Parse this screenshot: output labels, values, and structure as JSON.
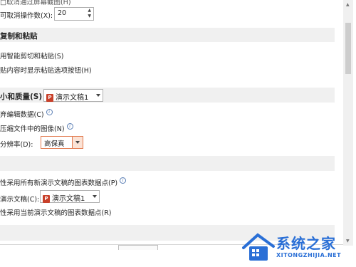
{
  "top_row": {
    "partial_label": "□取消通过屏幕截图(H)",
    "undo_label": "可取消操作数(X):",
    "undo_value": "20"
  },
  "section_copy": {
    "title": "复制和粘贴",
    "smart_cut": "用智能剪切和粘贴(S)",
    "show_paste": "贴内容时显示粘贴选项按钮(H)"
  },
  "section_size": {
    "title": "小和质量(S)",
    "doc_select": "演示文稿1",
    "discard_edit": "弃编辑数据(C)",
    "no_compress": "压缩文件中的图像(N)",
    "resolution_label": "分辨率(D):",
    "resolution_value": "高保真"
  },
  "section_chart": {
    "all_new": "性采用所有新演示文稿的图表数据点(P)",
    "current_label": "演示文稿(C):",
    "current_doc": "演示文稿1",
    "current_only": "性采用当前演示文稿的图表数据点(R)"
  },
  "watermark": {
    "brand": "系统之家",
    "url": "XITONGZHIJIA.NET"
  },
  "colors": {
    "section_bg": "#f0f0f0",
    "ppt_red": "#c8402a",
    "accent_orange": "#e27a4e",
    "info_blue": "#5b7fb5",
    "watermark_blue": "#2a6fd6"
  }
}
